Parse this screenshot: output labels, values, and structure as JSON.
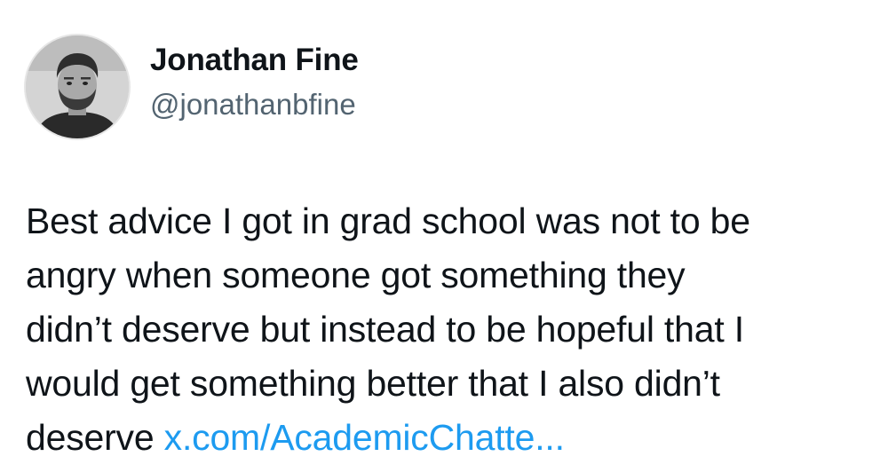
{
  "author": {
    "display_name": "Jonathan Fine",
    "handle": "@jonathanbfine",
    "avatar_icon": "profile-photo-avatar"
  },
  "tweet": {
    "lines": [
      "Best advice I got in grad school was not to be",
      "angry when someone got something they",
      "didn’t deserve but instead to be hopeful that I",
      "would get something better that I also didn’t",
      "deserve "
    ],
    "link_text": "x.com/AcademicChatte..."
  },
  "colors": {
    "text": "#0f1419",
    "secondary_text": "#536471",
    "link": "#1d9bf0",
    "background": "#ffffff"
  }
}
